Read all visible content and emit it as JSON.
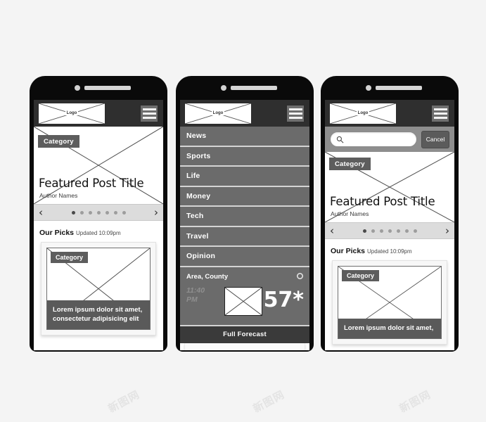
{
  "meta": {
    "background": "#f4f4f4",
    "watermark_text": "新图网",
    "accent_dark": "#2f2f2f",
    "accent_gray": "#6b6b6b",
    "chip_gray": "#5d5d5d"
  },
  "common": {
    "logo_label": "Logo",
    "hamburger_icon": "hamburger-menu-icon",
    "category_chip": "Category",
    "featured_title": "Featured Post Title",
    "featured_author": "Author Names",
    "carousel": {
      "prev_icon": "‹",
      "next_icon": "›",
      "dots_total": 7,
      "dot_active_index": 0
    },
    "picks": {
      "title": "Our Picks",
      "updated": "Updated 10:09pm"
    },
    "card": {
      "chip": "Category",
      "caption": "Lorem ipsum dolor sit amet, consectetur adipisicing elit",
      "caption_short": "Lorem ipsum dolor sit amet,"
    }
  },
  "phone1": {
    "name": "home-screen"
  },
  "phone2": {
    "name": "menu-screen",
    "menu_items": [
      {
        "label": "News"
      },
      {
        "label": "Sports"
      },
      {
        "label": "Life"
      },
      {
        "label": "Money"
      },
      {
        "label": "Tech"
      },
      {
        "label": "Travel"
      },
      {
        "label": "Opinion"
      }
    ],
    "weather": {
      "location": "Area, County",
      "time": "11:40 PM",
      "time_line1": "11:40",
      "time_line2": "PM",
      "temperature": "57*",
      "settings_icon": "gear-icon",
      "condition_icon": "weather-placeholder-icon"
    },
    "forecast_button": "Full Forecast"
  },
  "phone3": {
    "name": "search-screen",
    "search": {
      "value": "",
      "placeholder": "",
      "icon": "search-icon",
      "cancel_label": "Cancel"
    }
  }
}
